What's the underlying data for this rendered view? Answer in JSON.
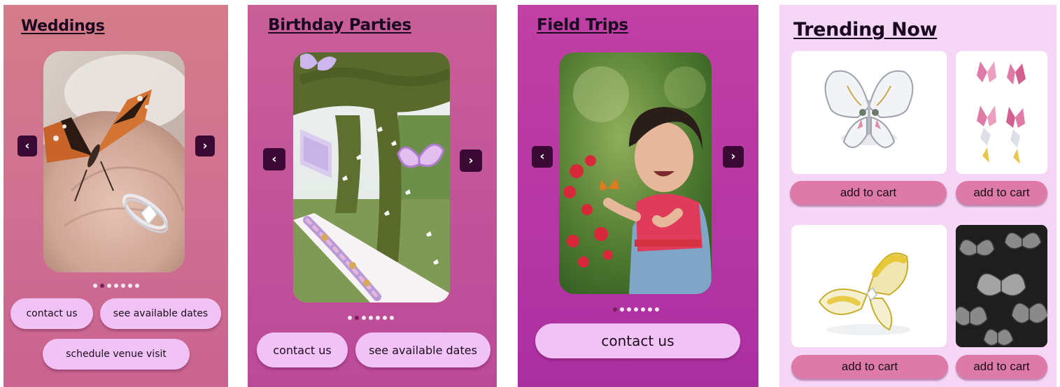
{
  "weddings": {
    "heading": "Weddings",
    "contact_label": "contact us",
    "dates_label": "see available dates",
    "visit_label": "schedule venue visit",
    "prev_glyph": "‹",
    "next_glyph": "›",
    "carousel_slides": 7,
    "active_slide": 2
  },
  "birthday": {
    "heading": "Birthday Parties",
    "contact_label": "contact us",
    "dates_label": "see available dates",
    "prev_glyph": "‹",
    "next_glyph": "›",
    "carousel_slides": 7,
    "active_slide": 2
  },
  "field_trips": {
    "heading": "Field Trips",
    "contact_label": "contact us",
    "prev_glyph": "‹",
    "next_glyph": "›",
    "carousel_slides": 7,
    "active_slide": 1
  },
  "trending": {
    "heading": "Trending Now",
    "products": [
      {
        "icon": "butterfly-ring-icon",
        "cart_label": "add to cart"
      },
      {
        "icon": "pink-earrings-icon",
        "cart_label": "add to cart"
      },
      {
        "icon": "yellow-butterfly-ring-icon",
        "cart_label": "add to cart"
      },
      {
        "icon": "butterfly-pattern-icon",
        "cart_label": "add to cart"
      }
    ]
  },
  "colors": {
    "arrow_bg": "#3a0a34",
    "pill_bg": "#f1c2f5",
    "cart_bg": "#de7aa8",
    "trending_bg": "#f5d6f7"
  }
}
